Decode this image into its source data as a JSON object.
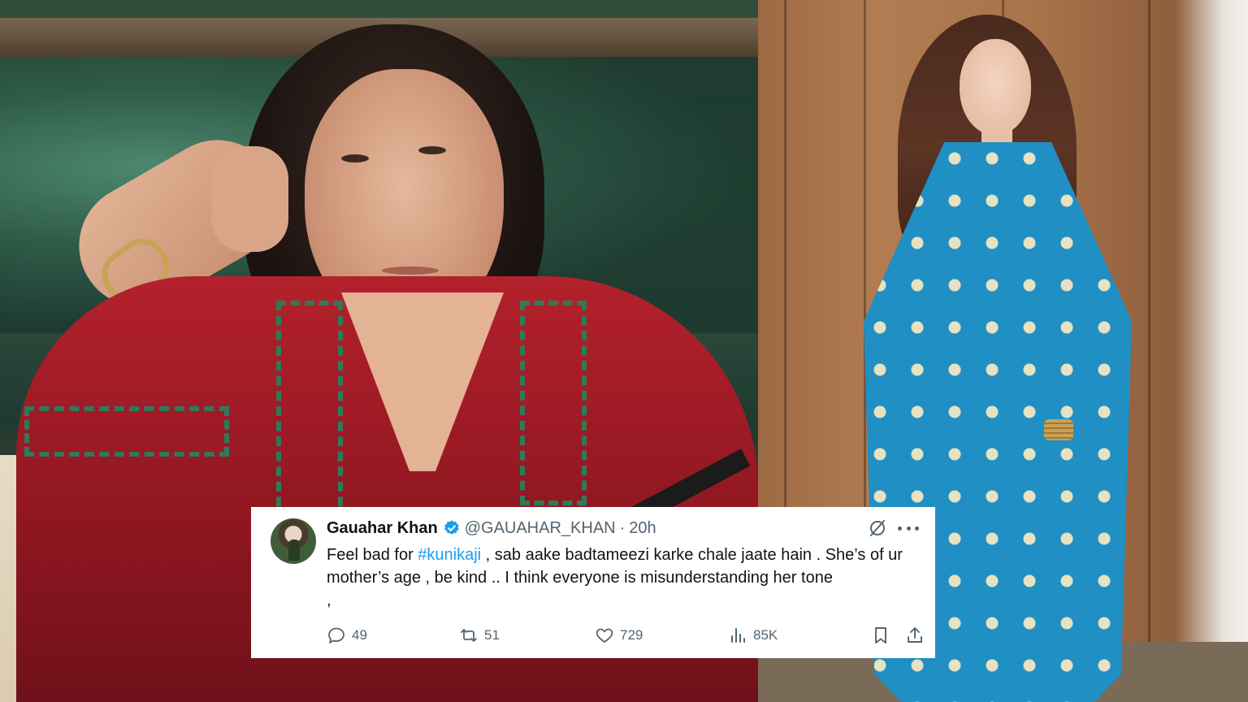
{
  "photos": {
    "left": {
      "alt": "woman in red embroidered kurta resting head on hand"
    },
    "right": {
      "alt": "woman in blue floral kurta set smiling"
    }
  },
  "tweet": {
    "author_name": "Gauahar Khan",
    "handle": "@GAUAHAR_KHAN",
    "separator": "·",
    "time": "20h",
    "text_before": "Feel bad for ",
    "hashtag": "#kunikaji",
    "text_after": " , sab aake badtameezi karke chale jaate hain . She’s of ur mother’s age , be kind .. I think everyone is misunderstanding her tone\n,",
    "replies": "49",
    "reposts": "51",
    "likes": "729",
    "views": "85K",
    "icons": [
      "verified-badge-icon",
      "grok-icon",
      "more-icon",
      "reply-icon",
      "repost-icon",
      "like-icon",
      "views-icon",
      "bookmark-icon",
      "share-icon"
    ],
    "colors": {
      "link": "#1d9bf0",
      "muted": "#536471",
      "text": "#0f1419"
    }
  }
}
